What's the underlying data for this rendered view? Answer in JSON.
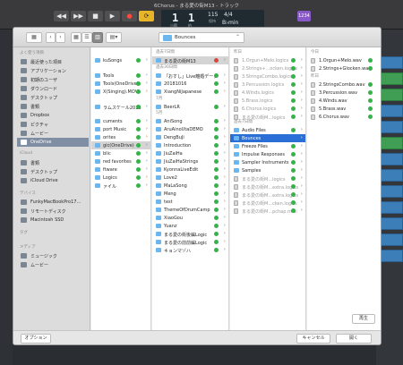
{
  "window_title": "6Chorus - まる愛の街M13 - トラック",
  "transport": {
    "rewind_icon": "rewind-icon",
    "forward_icon": "fast-forward-icon",
    "stop_icon": "stop-icon",
    "play_icon": "play-icon",
    "record_icon": "record-icon",
    "cycle_icon": "cycle-icon",
    "glyphs": [
      "◀◀",
      "▶▶",
      "■",
      "▶",
      "●",
      "⟳"
    ],
    "bar": "1",
    "beat": "1",
    "bar_label": "小節",
    "beat_label": "拍",
    "tempo": "115",
    "tempo_label": "保持",
    "key": "B♭min",
    "sig_top": "4/4",
    "badge": "1234"
  },
  "dialog": {
    "nav_back": "‹",
    "nav_forward": "›",
    "view_icons": [
      "▦",
      "☰",
      "▥",
      "▤▾"
    ],
    "current_folder": "Bounces",
    "sidebar": {
      "sections": [
        {
          "title": "よく使う項目",
          "items": [
            "最近使った項目",
            "アプリケーション",
            "初期のユーザ",
            "ダウンロード",
            "デスクトップ",
            "書類",
            "Dropbox",
            "ピクチャ",
            "ムービー",
            "OneDrive"
          ]
        },
        {
          "title": "iCloud",
          "items": [
            "書類",
            "デスクトップ",
            "iCloud Drive"
          ]
        },
        {
          "title": "デバイス",
          "items": [
            "FunkyMacBookPro17…",
            "リモートディスク",
            "Macintosh SSD"
          ]
        },
        {
          "title": "タグ",
          "items": []
        },
        {
          "title": "メディア",
          "items": [
            "ミュージック",
            "ムービー"
          ]
        }
      ],
      "selected": "OneDrive"
    },
    "col1": {
      "rows": [
        {
          "label": "kuSongs",
          "status": "green"
        },
        {
          "label": "Tools",
          "status": "green"
        },
        {
          "label": "Tools(OneDrive)",
          "status": "green"
        },
        {
          "label": "X(Singing).MOV",
          "status": "green"
        },
        {
          "label": "ラムスケール2018",
          "status": "green"
        },
        {
          "label": "cuments",
          "status": "green"
        },
        {
          "label": "port Music",
          "status": "green"
        },
        {
          "label": "orites",
          "status": "green"
        },
        {
          "label": "gic(OneDrive)",
          "status": "green"
        },
        {
          "label": "blic",
          "status": "green"
        },
        {
          "label": "red favorites",
          "status": "green"
        },
        {
          "label": "ftware",
          "status": "green"
        },
        {
          "label": "Logics",
          "status": "green"
        },
        {
          "label": "ァイル",
          "status": "green"
        }
      ]
    },
    "col2": {
      "heads": [
        "過去7日間",
        "過去30日間",
        "7月",
        "5月"
      ],
      "rows": [
        {
          "label": "まる愛の街M13",
          "status": "red"
        },
        {
          "label": "「おすし」Live離婚データ",
          "status": "green"
        },
        {
          "label": "20181016",
          "status": "green"
        },
        {
          "label": "XiangNiJapanese",
          "status": "green"
        },
        {
          "label": "BeerLR",
          "status": "green"
        },
        {
          "label": "AniSong",
          "status": "green"
        },
        {
          "label": "AruAinoUtaDEMO",
          "status": "green"
        },
        {
          "label": "DengBuJi",
          "status": "green"
        },
        {
          "label": "Introduction",
          "status": "green"
        },
        {
          "label": "JiuZaiHa",
          "status": "green"
        },
        {
          "label": "JiuZaiHaStrings",
          "status": "green"
        },
        {
          "label": "KyonnaLiveEdit",
          "status": "green"
        },
        {
          "label": "Love2",
          "status": "green"
        },
        {
          "label": "MaLaSong",
          "status": "green"
        },
        {
          "label": "Meng",
          "status": "green"
        },
        {
          "label": "test",
          "status": "green"
        },
        {
          "label": "ThemeOfDrumCamp",
          "status": "green"
        },
        {
          "label": "XiaoGou",
          "status": "green"
        },
        {
          "label": "Yuanz",
          "status": "green"
        },
        {
          "label": "まる愛の街後編Logic",
          "status": "green"
        },
        {
          "label": "まる愛の前前編Logic",
          "status": "green"
        },
        {
          "label": "キョンマゾハ",
          "status": "green"
        }
      ]
    },
    "col3": {
      "heads": [
        "昨日",
        "過去7日間"
      ],
      "rows": [
        {
          "label": "1.Orgun+Melo.logics",
          "status": "green",
          "dim": true
        },
        {
          "label": "2.Strings+...ocken.logics",
          "status": "green",
          "dim": true
        },
        {
          "label": "3.StringsCombo.logics",
          "status": "green",
          "dim": true
        },
        {
          "label": "3.Percussion.logics",
          "status": "green",
          "dim": true
        },
        {
          "label": "4.Winds.logics",
          "status": "green",
          "dim": true
        },
        {
          "label": "5.Brass.logics",
          "status": "green",
          "dim": true
        },
        {
          "label": "6.Chorus.logics",
          "status": "green",
          "dim": true
        },
        {
          "label": "まる愛の街M...logics",
          "status": "green",
          "dim": true
        },
        {
          "label": "Audio Files",
          "status": "green",
          "folder": true
        },
        {
          "label": "Bounces",
          "status": "",
          "folder": true,
          "selected": true
        },
        {
          "label": "Freeze Files",
          "status": "green",
          "folder": true
        },
        {
          "label": "Impulse Responses",
          "status": "green",
          "folder": true
        },
        {
          "label": "Sampler Instruments",
          "status": "green",
          "folder": true
        },
        {
          "label": "Samples",
          "status": "green",
          "folder": true
        },
        {
          "label": "まる愛の街M...logics",
          "status": "green",
          "dim": true
        },
        {
          "label": "まる愛の街M...extra.logics",
          "status": "green",
          "dim": true
        },
        {
          "label": "まる愛の街M...extra.logics",
          "status": "green",
          "dim": true
        },
        {
          "label": "まる愛の街M...cken.logics",
          "status": "green",
          "dim": true
        },
        {
          "label": "まる愛の街M...pchap.midi",
          "status": "green",
          "dim": true
        }
      ]
    },
    "col4": {
      "heads": [
        "今日",
        "昨日"
      ],
      "rows": [
        {
          "label": "1.Orgun+Melo.wav",
          "status": "green"
        },
        {
          "label": "2.Strings+Glocken.wav",
          "status": "green"
        },
        {
          "label": "2.StringsCombo.wav",
          "status": "green"
        },
        {
          "label": "3.Percussion.wav",
          "status": "green"
        },
        {
          "label": "4.Winds.wav",
          "status": "green"
        },
        {
          "label": "5.Brass.wav",
          "status": "green"
        },
        {
          "label": "6.Chorus.wav",
          "status": "green"
        }
      ]
    },
    "play_label": "再生",
    "options_label": "オプション",
    "cancel_label": "キャンセル",
    "open_label": "開く"
  }
}
